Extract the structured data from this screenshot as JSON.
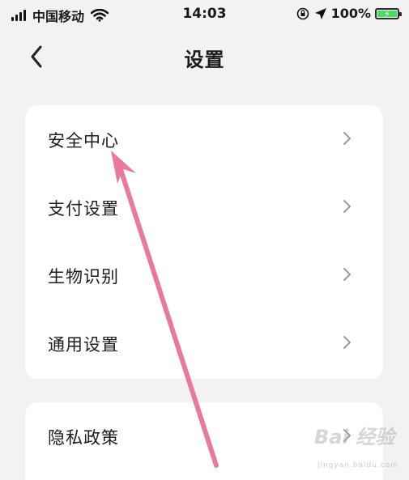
{
  "status_bar": {
    "carrier": "中国移动",
    "time": "14:03",
    "battery_percent": "100%"
  },
  "nav": {
    "title": "设置",
    "back_icon": "chevron-left-icon"
  },
  "settings_group_1": {
    "items": [
      {
        "label": "安全中心"
      },
      {
        "label": "支付设置"
      },
      {
        "label": "生物识别"
      },
      {
        "label": "通用设置"
      }
    ]
  },
  "settings_group_2": {
    "items": [
      {
        "label": "隐私政策"
      }
    ]
  },
  "annotation": {
    "arrow_color": "#e9799f"
  },
  "watermark": {
    "text": "Bai 经验",
    "sub": "jingyan.baidu.com"
  },
  "colors": {
    "background": "#f2f2f2",
    "card": "#ffffff",
    "battery_fill": "#4cd964"
  }
}
